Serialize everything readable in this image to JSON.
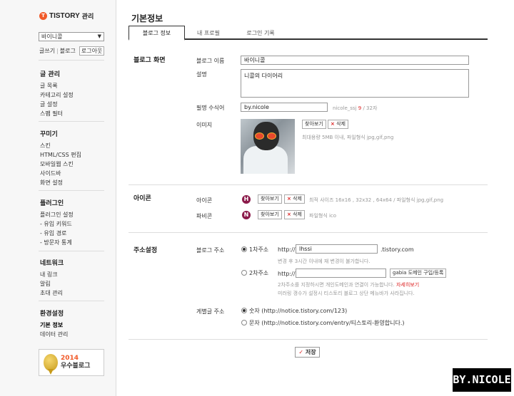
{
  "sidebar": {
    "logo": "TISTORY",
    "logo_sub": "관리",
    "blog_select": "바이니콜",
    "links": {
      "write": "글쓰기",
      "blog": "블로그",
      "logout": "로그아웃"
    },
    "groups": [
      {
        "title": "글 관리",
        "items": [
          "글 목록",
          "카테고리 설정",
          "글 설정",
          "스팸 필터"
        ]
      },
      {
        "title": "꾸미기",
        "items": [
          "스킨",
          "HTML/CSS 편집",
          "모바일웹 스킨",
          "사이드바",
          "화면 설정"
        ]
      },
      {
        "title": "플러그인",
        "items": [
          "플러그인 설정",
          "- 유입 키워드",
          "- 유입 경로",
          "- 방문자 통계"
        ]
      },
      {
        "title": "네트워크",
        "items": [
          "내 링크",
          "알림",
          "초대 관리"
        ]
      },
      {
        "title": "환경설정",
        "items": [
          "기본 정보",
          "데이터 관리"
        ]
      }
    ],
    "badge": {
      "year": "2014",
      "text": "우수블로그"
    }
  },
  "page_title": "기본정보",
  "tabs": [
    "블로그 정보",
    "내 프로필",
    "로그인 기록"
  ],
  "blog_section": {
    "label": "블로그 화면",
    "name_label": "블로그 이름",
    "name_value": "바이니콜",
    "desc_label": "설명",
    "desc_value": "니콜의 다이어리",
    "nick_label": "필명 수식어",
    "nick_value": "by.nicole",
    "nick_hint_pre": "nicole_ssj",
    "nick_hint_count": "9",
    "nick_hint_post": "/ 32자",
    "image_label": "이미지",
    "find_btn": "찾아보기",
    "delete_btn": "삭제",
    "image_hint": "최대용량 5MB 이내, 파일형식 jpg,gif,png"
  },
  "icon_section": {
    "label": "아이콘",
    "icon_label": "아이콘",
    "favicon_label": "파비콘",
    "icon_glyph": "H",
    "favicon_glyph": "N",
    "find_btn": "찾아보기",
    "delete_btn": "삭제",
    "icon_hint": "최적 사이즈 16x16 , 32x32 , 64x64 / 파일형식 jpg,gif,png",
    "favicon_hint": "파일형식 ico"
  },
  "address_section": {
    "label": "주소설정",
    "blog_addr_label": "블로그 주소",
    "primary_label": "1차주소",
    "http": "http://",
    "primary_value": "lhssi",
    "primary_suffix": ".tistory.com",
    "primary_hint": "변경 후 3시간 이내에 재 변경이 불가합니다.",
    "secondary_label": "2차주소",
    "secondary_value": "",
    "gabia_btn": "gabia 도메인 구입/등록",
    "secondary_hint1_pre": "2차주소를 지정하시면 개인도메인과 연결이 가능합니다.",
    "secondary_hint1_link": "자세히보기",
    "secondary_hint2": "미러링 갱수가 설정시 티스토리 블로그 상단 메뉴바가 사라집니다.",
    "permalink_label": "게별글 주소",
    "opt_number": "숫자 (http://notice.tistory.com/123)",
    "opt_text": "문자 (http://notice.tistory.com/entry/티스토리-환영합니다.)"
  },
  "save_btn": "저장",
  "watermark": "BY.NICOLE"
}
